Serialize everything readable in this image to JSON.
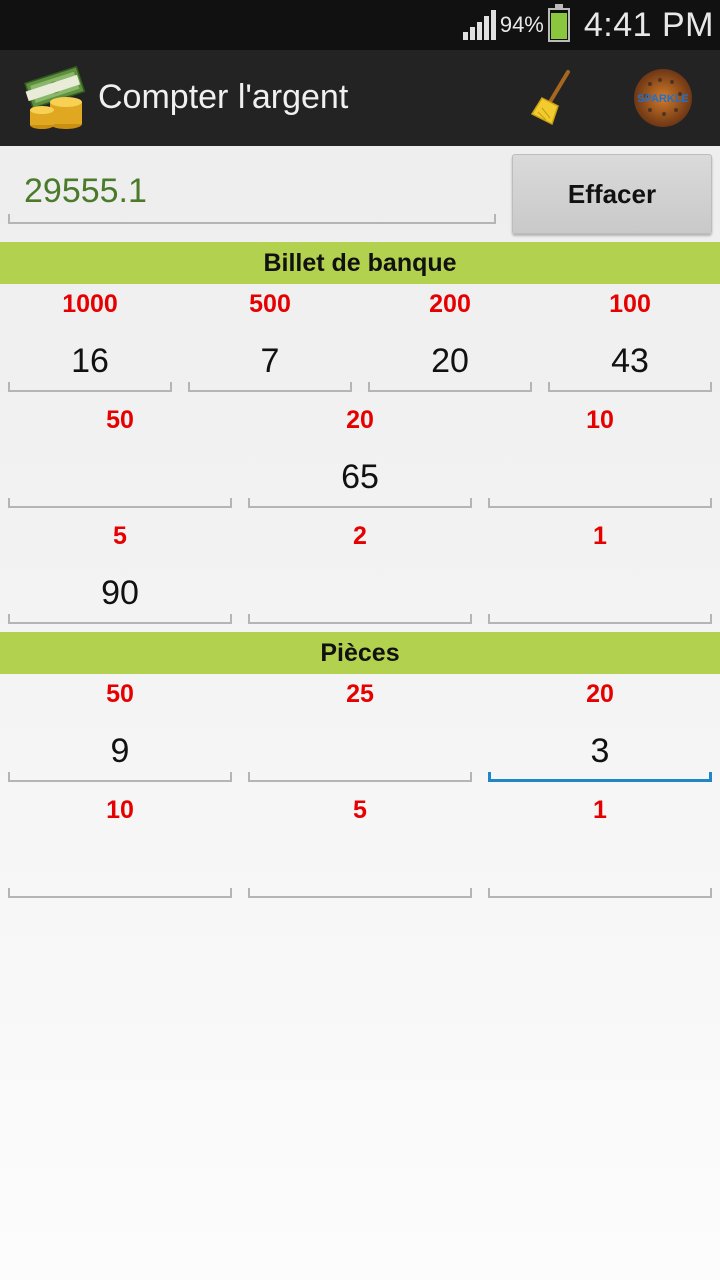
{
  "status_bar": {
    "battery_percent": "94%",
    "time": "4:41 PM"
  },
  "action_bar": {
    "title": "Compter l'argent",
    "icons": [
      "money-icon",
      "broom-icon",
      "sparkle-logo-icon"
    ],
    "logo_text": "SPARKLE"
  },
  "total": {
    "value": "29555.1"
  },
  "clear_button": {
    "label": "Effacer"
  },
  "banknotes": {
    "header": "Billet de banque",
    "rows": [
      [
        {
          "denom": "1000",
          "count": "16"
        },
        {
          "denom": "500",
          "count": "7"
        },
        {
          "denom": "200",
          "count": "20"
        },
        {
          "denom": "100",
          "count": "43"
        }
      ],
      [
        {
          "denom": "50",
          "count": ""
        },
        {
          "denom": "20",
          "count": "65"
        },
        {
          "denom": "10",
          "count": ""
        }
      ],
      [
        {
          "denom": "5",
          "count": "90"
        },
        {
          "denom": "2",
          "count": ""
        },
        {
          "denom": "1",
          "count": ""
        }
      ]
    ]
  },
  "coins": {
    "header": "Pièces",
    "rows": [
      [
        {
          "denom": "50",
          "count": "9"
        },
        {
          "denom": "25",
          "count": ""
        },
        {
          "denom": "20",
          "count": "3"
        }
      ],
      [
        {
          "denom": "10",
          "count": ""
        },
        {
          "denom": "5",
          "count": ""
        },
        {
          "denom": "1",
          "count": ""
        }
      ]
    ]
  },
  "colors": {
    "accent_green": "#b2d14e",
    "denom_red": "#e60000",
    "total_green": "#4a7a2a",
    "focus_blue": "#1e88c7"
  }
}
